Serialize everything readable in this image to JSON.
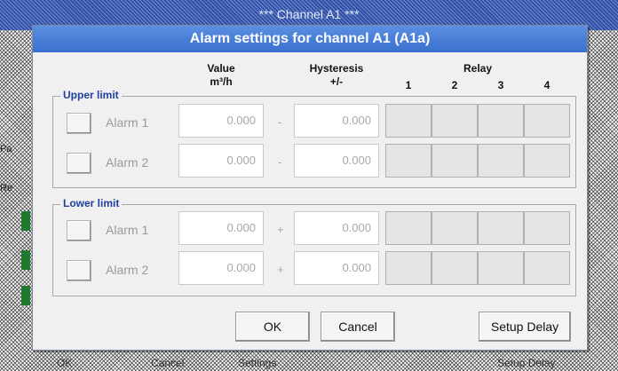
{
  "background": {
    "title": "*** Channel A1 ***",
    "corner_text": "",
    "side_labels": [
      "Pa",
      "Re"
    ],
    "bottom_labels": [
      "OK",
      "Cancel",
      "Settings",
      "Setup Delay"
    ]
  },
  "dialog": {
    "title": "Alarm settings for channel A1 (A1a)",
    "headers": {
      "value": "Value",
      "value_unit": "m³/h",
      "hysteresis": "Hysteresis",
      "hysteresis_unit": "+/-",
      "relay": "Relay",
      "relay_numbers": [
        "1",
        "2",
        "3",
        "4"
      ]
    },
    "upper": {
      "label": "Upper limit",
      "alarms": [
        {
          "label": "Alarm 1",
          "value": "0.000",
          "sign": "-",
          "hysteresis": "0.000"
        },
        {
          "label": "Alarm 2",
          "value": "0.000",
          "sign": "-",
          "hysteresis": "0.000"
        }
      ]
    },
    "lower": {
      "label": "Lower limit",
      "alarms": [
        {
          "label": "Alarm 1",
          "value": "0.000",
          "sign": "+",
          "hysteresis": "0.000"
        },
        {
          "label": "Alarm 2",
          "value": "0.000",
          "sign": "+",
          "hysteresis": "0.000"
        }
      ]
    },
    "buttons": {
      "ok": "OK",
      "cancel": "Cancel",
      "setup_delay": "Setup Delay"
    }
  },
  "colors": {
    "header": "#3a6fcf",
    "group_label": "#1f3fa0",
    "dialog_bg": "#f0f0f0"
  }
}
